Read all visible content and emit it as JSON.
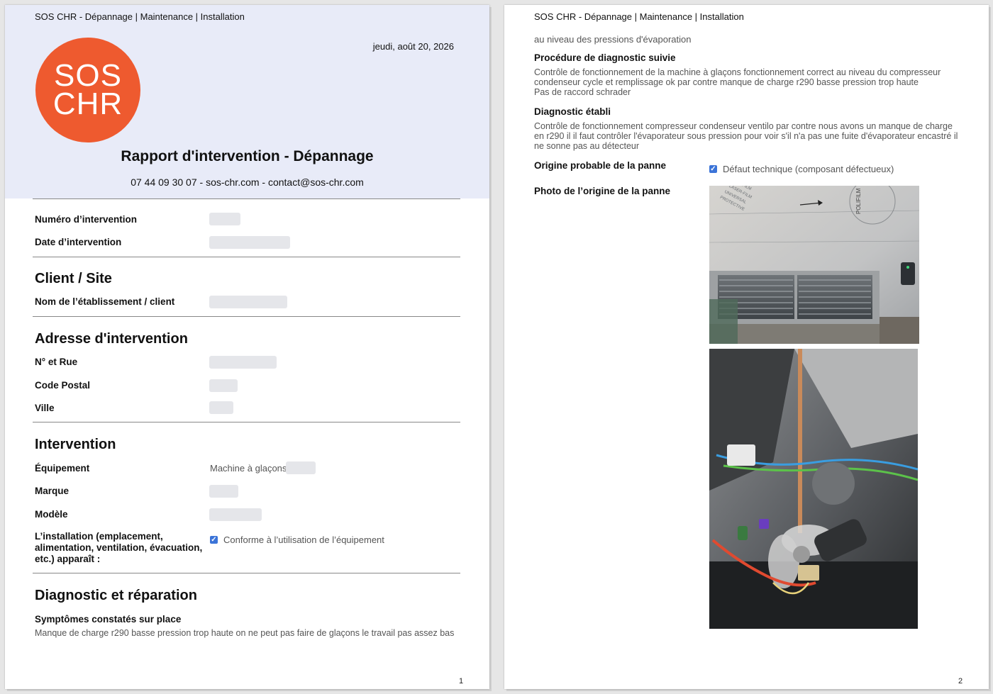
{
  "company_line": "SOS CHR - Dépannage | Maintenance | Installation",
  "date": "jeudi, août 20, 2026",
  "logo": {
    "line1": "SOS",
    "line2": "CHR",
    "color": "#ee5a2f"
  },
  "report_title": "Rapport d'intervention - Dépannage",
  "contact": "07 44 09 30 07 - sos-chr.com - contact@sos-chr.com",
  "fields": {
    "numero": "Numéro d’intervention",
    "date_intervention": "Date d’intervention"
  },
  "client": {
    "title": "Client / Site",
    "nom_label": "Nom de l’établissement / client"
  },
  "adresse": {
    "title": "Adresse d'intervention",
    "rue_label": "N° et Rue",
    "cp_label": "Code Postal",
    "ville_label": "Ville"
  },
  "intervention": {
    "title": "Intervention",
    "equipement_label": "Équipement",
    "equipement_value": "Machine à glaçons",
    "marque_label": "Marque",
    "modele_label": "Modèle",
    "installation_label": "L’installation (emplacement, alimentation, ventilation, évacuation, etc.) apparaît :",
    "installation_value": "Conforme à l’utilisation de l’équipement"
  },
  "diagnostic": {
    "title": "Diagnostic et réparation",
    "symptomes_label": "Symptômes constatés sur place",
    "symptomes_value": "Manque de charge r290 basse pression trop haute on ne peut pas faire de glaçons le travail pas assez bas",
    "symptomes_continued": "au niveau des pressions d'évaporation",
    "procedure_label": "Procédure de diagnostic suivie",
    "procedure_value": "Contrôle de fonctionnement de la machine à glaçons fonctionnement correct au niveau du compresseur condenseur cycle et remplissage ok par contre manque de charge r290 basse pression trop haute\nPas de raccord schrader",
    "etabli_label": "Diagnostic établi",
    "etabli_value": "Contrôle de fonctionnement compresseur condenseur ventilo par contre nous avons un manque de charge en r290 il il faut contrôler l'évaporateur sous pression pour voir s'il n'a pas une fuite d'évaporateur encastré il ne sonne pas au détecteur",
    "origine_label": "Origine probable de la panne",
    "origine_value": "Défaut technique (composant défectueux)",
    "photo_label": "Photo de l’origine de la panne"
  },
  "photo1_text": {
    "brand": "POLIFILM",
    "lines": [
      "POLIFILM",
      "LASER-FILM",
      "UNIVERSAL",
      "PROTECTIVE"
    ]
  },
  "page_numbers": {
    "p1": "1",
    "p2": "2"
  },
  "colors": {
    "header_band": "#e8ebf8",
    "checkbox": "#3b74d8"
  }
}
